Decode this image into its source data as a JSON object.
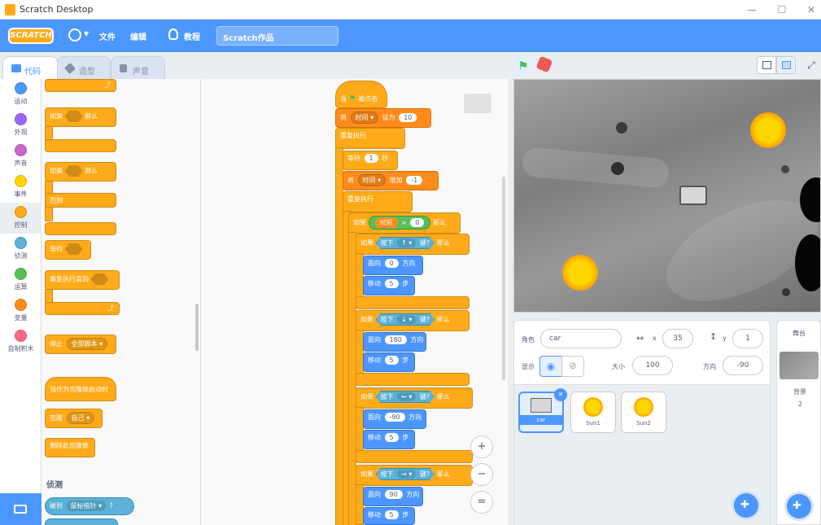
{
  "window": {
    "title": "Scratch Desktop",
    "min": "—",
    "max": "☐",
    "close": "✕"
  },
  "menu": {
    "logo": "SCRATCH",
    "file": "文件",
    "edit": "编辑",
    "tutorials": "教程",
    "project_title": "Scratch作品"
  },
  "tabs": [
    {
      "label": "代码"
    },
    {
      "label": "造型"
    },
    {
      "label": "声音"
    }
  ],
  "categories": [
    {
      "label": "运动",
      "color": "#4c97ff"
    },
    {
      "label": "外观",
      "color": "#9966ff"
    },
    {
      "label": "声音",
      "color": "#cf63cf"
    },
    {
      "label": "事件",
      "color": "#ffd500"
    },
    {
      "label": "控制",
      "color": "#ffab19"
    },
    {
      "label": "侦测",
      "color": "#5cb1d6"
    },
    {
      "label": "运算",
      "color": "#59c059"
    },
    {
      "label": "变量",
      "color": "#ff8c1a"
    },
    {
      "label": "自制积木",
      "color": "#ff6680"
    }
  ],
  "palette": {
    "if_then": {
      "a": "如果",
      "b": "那么"
    },
    "if_else": {
      "a": "如果",
      "b": "那么",
      "else": "否则"
    },
    "wait_until": "等待",
    "repeat_until": "重复执行直到",
    "stop": {
      "label": "停止",
      "option": "全部脚本"
    },
    "clone_start": "当作为克隆体启动时",
    "clone": {
      "label": "克隆",
      "option": "自己"
    },
    "delete_clone": "删除此克隆体",
    "sensing_heading": "侦测",
    "touching": {
      "label": "碰到",
      "option": "鼠标指针",
      "q": "?"
    }
  },
  "script": {
    "hat": {
      "a": "当",
      "b": "被点击"
    },
    "set_var": {
      "a": "将",
      "var": "时间",
      "b": "设为",
      "value": "10"
    },
    "forever1": "重复执行",
    "wait": {
      "a": "等待",
      "value": "1",
      "b": "秒"
    },
    "change_var": {
      "a": "将",
      "var": "时间",
      "b": "增加",
      "value": "-1"
    },
    "forever2": "重复执行",
    "if_time": {
      "a": "如果",
      "var": "时间",
      "op": ">",
      "value": "0",
      "b": "那么"
    },
    "ifs": [
      {
        "a": "如果",
        "k": "按下",
        "key": "↑",
        "q": "键?",
        "b": "那么",
        "dir_label": "面向",
        "dir": "0",
        "dir_unit": "方向",
        "move_label": "移动",
        "steps": "5",
        "step_unit": "步"
      },
      {
        "a": "如果",
        "k": "按下",
        "key": "↓",
        "q": "键?",
        "b": "那么",
        "dir_label": "面向",
        "dir": "180",
        "dir_unit": "方向",
        "move_label": "移动",
        "steps": "5",
        "step_unit": "步"
      },
      {
        "a": "如果",
        "k": "按下",
        "key": "←",
        "q": "键?",
        "b": "那么",
        "dir_label": "面向",
        "dir": "-90",
        "dir_unit": "方向",
        "move_label": "移动",
        "steps": "5",
        "step_unit": "步"
      },
      {
        "a": "如果",
        "k": "按下",
        "key": "→",
        "q": "键?",
        "b": "那么",
        "dir_label": "面向",
        "dir": "90",
        "dir_unit": "方向",
        "move_label": "移动",
        "steps": "5",
        "step_unit": "步"
      }
    ],
    "zoom_in": "+",
    "zoom_out": "−",
    "zoom_reset": "="
  },
  "sprite_info": {
    "sprite_label": "角色",
    "sprite_name": "car",
    "x_label": "x",
    "x": "35",
    "y_label": "y",
    "y": "1",
    "show_label": "显示",
    "size_label": "大小",
    "size": "100",
    "direction_label": "方向",
    "direction": "-90"
  },
  "sprites": [
    {
      "name": "car"
    },
    {
      "name": "Sun1"
    },
    {
      "name": "Sun2"
    }
  ],
  "stage_panel": {
    "title": "舞台",
    "backdrop_label": "背景",
    "backdrop_count": "2"
  }
}
